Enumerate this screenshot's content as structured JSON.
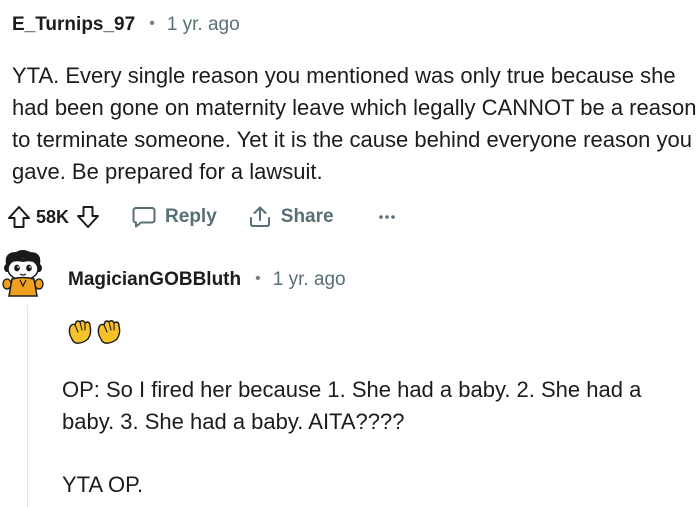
{
  "top_comment": {
    "username": "E_Turnips_97",
    "separator": "•",
    "age": "1 yr. ago",
    "body": "YTA. Every single reason you mentioned was only true because she had been gone on maternity leave which legally CANNOT be a reason to terminate someone. Yet it is the cause behind everyone reason you gave. Be prepared for a lawsuit.",
    "vote_count": "58K",
    "reply_label": "Reply",
    "share_label": "Share",
    "more_label": "•••"
  },
  "reply_comment": {
    "username": "MagicianGOBBluth",
    "separator": "•",
    "age": "1 yr. ago",
    "emojis": [
      "clapping-hands",
      "clapping-hands"
    ],
    "paragraph1": "OP: So I fired her because 1. She had a baby. 2. She had a baby. 3. She had a baby. AITA????",
    "paragraph2": "YTA OP."
  },
  "colors": {
    "text": "#1c1c1c",
    "muted": "#576f76",
    "thread_line": "#e5e5e5",
    "emoji_yellow": "#f7c12a",
    "avatar_orange": "#f0a020"
  }
}
